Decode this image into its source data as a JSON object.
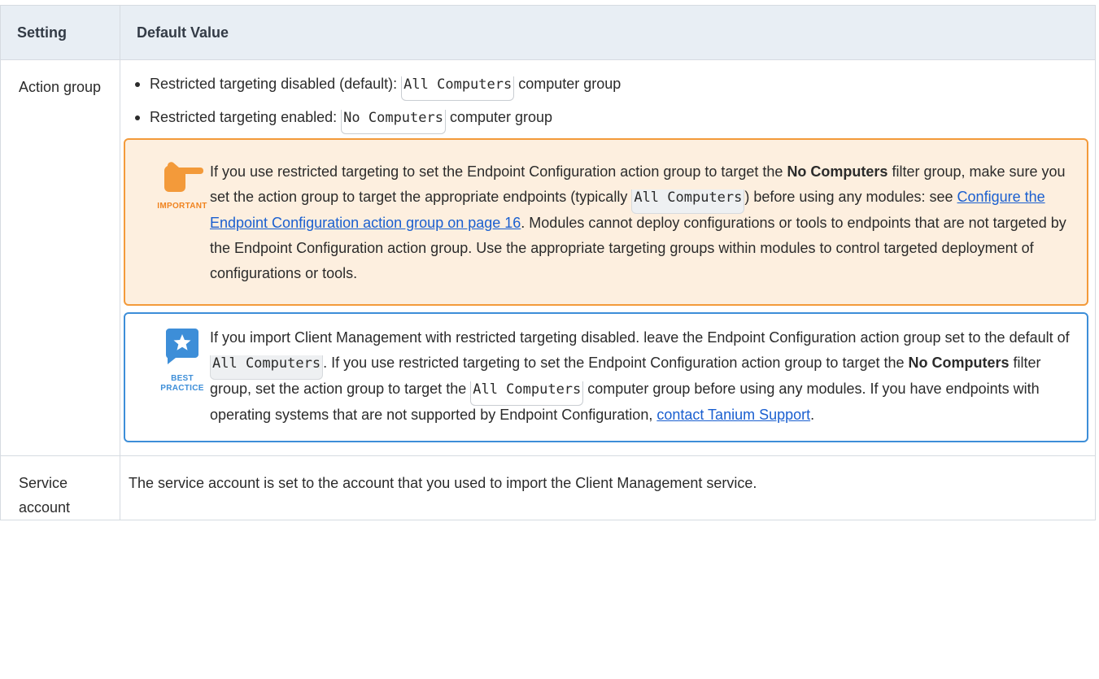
{
  "table": {
    "headers": [
      "Setting",
      "Default Value"
    ],
    "rows": [
      {
        "setting": "Action group",
        "bullets": [
          {
            "before": "Restricted targeting disabled (default): ",
            "code": "All Computers",
            "after": " computer group"
          },
          {
            "before": "Restricted targeting enabled: ",
            "code": "No Computers",
            "after": " computer group"
          }
        ],
        "important": {
          "icon_caption": "IMPORTANT",
          "t1": "If you use restricted targeting to set the Endpoint Configuration action group to target the ",
          "b1": "No Computers",
          "t2": " filter group, make sure you set the action group to target the appropriate endpoints (typically ",
          "code": "All Computers",
          "t3": ") before using any modules: see ",
          "link": "Configure the Endpoint Configuration action group on page 16",
          "t4": ". Modules cannot deploy configurations or tools to endpoints that are not targeted by the Endpoint Configuration action group. Use the appropriate targeting groups within modules to control targeted deployment of configurations or tools."
        },
        "best_practice": {
          "icon_caption": "BEST PRACTICE",
          "t1": "If you import Client Management with restricted targeting disabled. leave the Endpoint Configuration action group set to the default of ",
          "code1": "All Computers",
          "t2": ".  If you use restricted targeting to set the Endpoint Configuration action group to target the ",
          "b1": "No Computers",
          "t3": " filter group, set the action group to target the ",
          "code2": "All Computers",
          "t4": " computer group before using any modules. If you have endpoints with operating systems that are not supported by Endpoint Configuration, ",
          "link": "contact Tanium Support",
          "t5": "."
        }
      },
      {
        "setting": "Service account",
        "value": "The service account is set to the account that you used to import the Client Management service."
      }
    ]
  },
  "colors": {
    "important_accent": "#f39a3a",
    "best_practice_accent": "#3d8ed8",
    "header_bg": "#e8eef4",
    "link": "#1a5fd0"
  },
  "icons": {
    "important": "pointing-hand-icon",
    "best_practice": "star-speech-bubble-icon"
  }
}
